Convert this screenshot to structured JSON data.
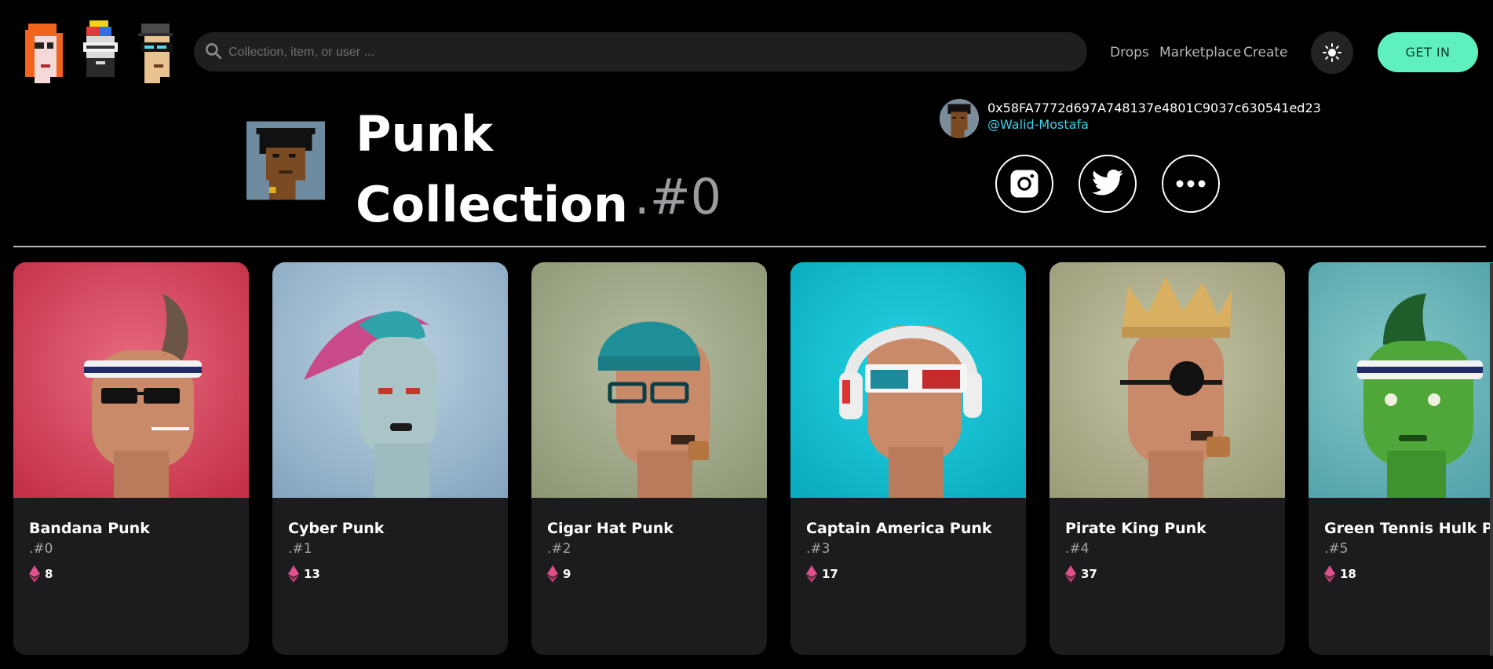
{
  "header": {
    "search_placeholder": "Collection, item, or user ...",
    "nav": [
      "Drops",
      "Marketplace",
      "Create"
    ],
    "get_in_label": "GET IN",
    "theme_icon": "sun-icon"
  },
  "hero": {
    "title": "Punk Collection",
    "token": ".#0",
    "owner_address": "0x58FA7772d697A748137e4801C9037c630541ed23",
    "owner_handle": "@Walid-Mostafa",
    "social_icons": [
      "instagram-icon",
      "twitter-icon",
      "more-icon"
    ]
  },
  "colors": {
    "accent": "#5ef1bf",
    "handle": "#3fd1ea",
    "card_bg": "#1c1c1f",
    "eth_pink": "#e0508a"
  },
  "cards": [
    {
      "name": "Bandana Punk",
      "num": ".#0",
      "price": "8"
    },
    {
      "name": "Cyber Punk",
      "num": ".#1",
      "price": "13"
    },
    {
      "name": "Cigar Hat Punk",
      "num": ".#2",
      "price": "9"
    },
    {
      "name": "Captain America Punk",
      "num": ".#3",
      "price": "17"
    },
    {
      "name": "Pirate King Punk",
      "num": ".#4",
      "price": "37"
    },
    {
      "name": "Green Tennis Hulk Punk",
      "num": ".#5",
      "price": "18"
    }
  ]
}
